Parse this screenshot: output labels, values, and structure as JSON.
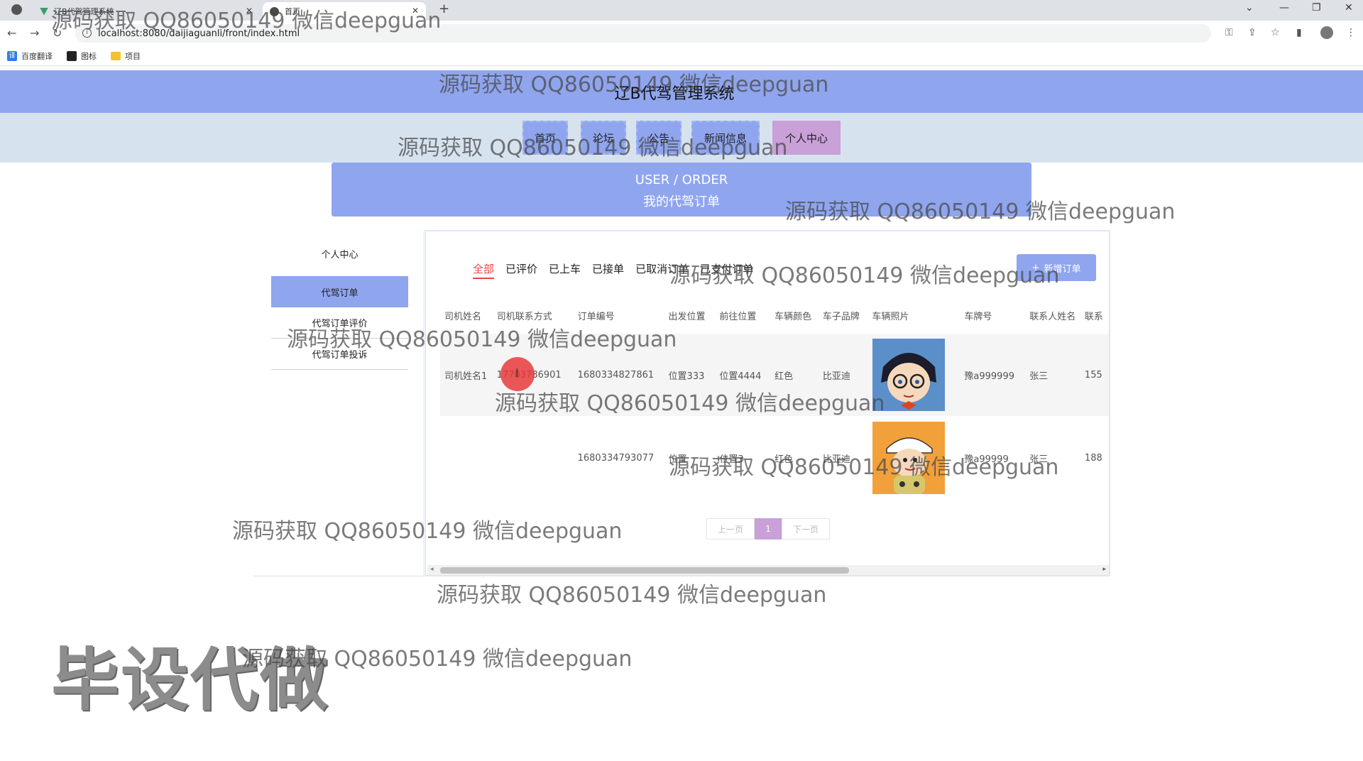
{
  "browser": {
    "tabs": [
      {
        "title": "辽B代驾管理系统"
      },
      {
        "title": "首页"
      }
    ],
    "url": "localhost:8080/daijiaguanli/front/index.html",
    "bookmarks": [
      "百度翻译",
      "图标",
      "项目"
    ]
  },
  "site": {
    "title": "辽B代驾管理系统",
    "nav": [
      "首页",
      "论坛",
      "公告",
      "新闻信息",
      "个人中心"
    ],
    "banner_en": "USER / ORDER",
    "banner_cn": "我的代驾订单"
  },
  "sidebar": {
    "items": [
      "个人中心",
      "代驾订单",
      "代驾订单评价",
      "代驾订单投诉"
    ]
  },
  "filters": [
    "全部",
    "已评价",
    "已上车",
    "已接单",
    "已取消订单",
    "已支付订单"
  ],
  "add_button": "新增订单",
  "table": {
    "headers": [
      "司机姓名",
      "司机联系方式",
      "订单编号",
      "出发位置",
      "前往位置",
      "车辆颜色",
      "车子品牌",
      "车辆照片",
      "车牌号",
      "联系人姓名",
      "联系"
    ],
    "rows": [
      {
        "driver": "司机姓名1",
        "phone": "17703786901",
        "order_no": "1680334827861",
        "from": "位置333",
        "to": "位置4444",
        "color": "红色",
        "brand": "比亚迪",
        "plate": "豫a999999",
        "contact": "张三",
        "contact_phone": "155"
      },
      {
        "driver": "",
        "phone": "",
        "order_no": "1680334793077",
        "from": "位置",
        "to": "位置3",
        "color": "红色",
        "brand": "比亚迪",
        "plate": "豫a99999",
        "contact": "张三",
        "contact_phone": "188"
      }
    ]
  },
  "pager": {
    "prev": "上一页",
    "current": "1",
    "next": "下一页"
  },
  "watermark": "源码获取 QQ86050149 微信deepguan",
  "big_watermark": "毕设代做"
}
